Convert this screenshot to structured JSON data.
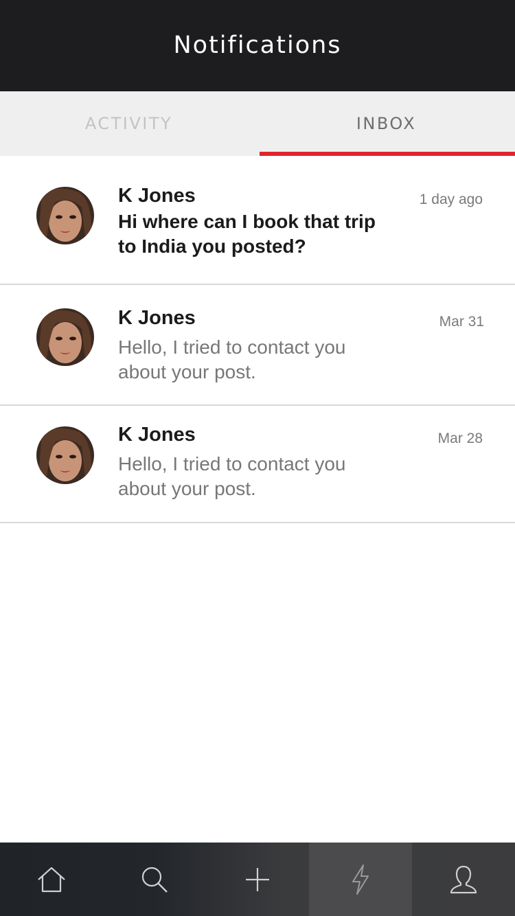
{
  "header": {
    "title": "Notifications"
  },
  "tabs": [
    {
      "label": "ACTIVITY",
      "active": false
    },
    {
      "label": "INBOX",
      "active": true
    }
  ],
  "accent_color": "#e2232b",
  "messages": [
    {
      "sender": "K Jones",
      "preview": "Hi where can I book that trip to India you posted?",
      "time": "1 day ago",
      "unread": true
    },
    {
      "sender": "K Jones",
      "preview": "Hello, I tried to contact you about your post.",
      "time": "Mar 31",
      "unread": false
    },
    {
      "sender": "K Jones",
      "preview": "Hello, I tried to contact you about your post.",
      "time": "Mar 28",
      "unread": false
    }
  ],
  "tabbar": {
    "items": [
      {
        "icon": "home-icon",
        "active": false
      },
      {
        "icon": "search-icon",
        "active": false
      },
      {
        "icon": "plus-icon",
        "active": false
      },
      {
        "icon": "lightning-icon",
        "active": true
      },
      {
        "icon": "user-icon",
        "active": false
      }
    ]
  }
}
